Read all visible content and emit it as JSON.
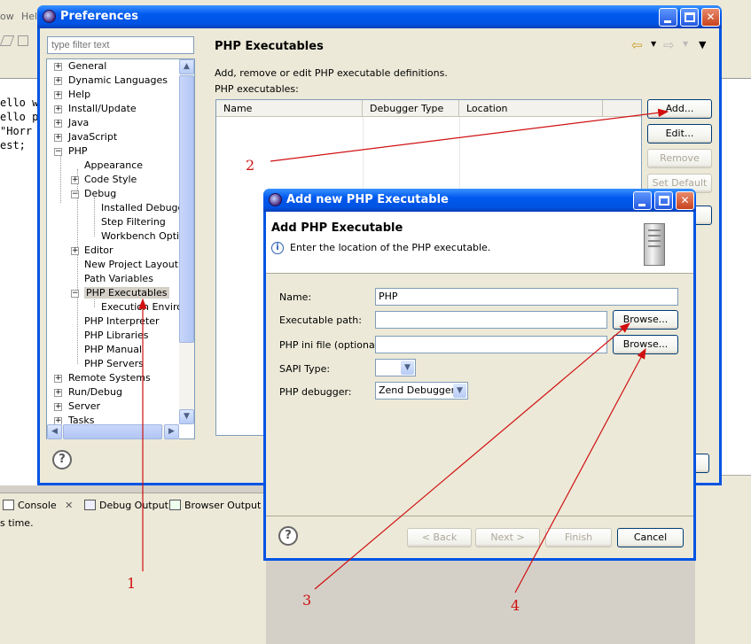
{
  "background": {
    "menu": [
      "ow",
      "Help"
    ],
    "editor_lines": [
      "ello w",
      "ello p",
      "\"Horr",
      "est;"
    ],
    "console_tabs": [
      "Console",
      "Debug Output",
      "Browser Output"
    ],
    "console_text": "s time."
  },
  "preferences": {
    "title": "Preferences",
    "filter_placeholder": "type filter text",
    "tree": {
      "general": "General",
      "dynamic_languages": "Dynamic Languages",
      "help": "Help",
      "install_update": "Install/Update",
      "java": "Java",
      "javascript": "JavaScript",
      "php": "PHP",
      "appearance": "Appearance",
      "code_style": "Code Style",
      "debug": "Debug",
      "installed_debuggers": "Installed Debugge",
      "step_filtering": "Step Filtering",
      "workbench_options": "Workbench Option",
      "editor": "Editor",
      "new_project_layout": "New Project Layout",
      "path_variables": "Path Variables",
      "php_executables": "PHP Executables",
      "execution_environments": "Execution Environ",
      "php_interpreter": "PHP Interpreter",
      "php_libraries": "PHP Libraries",
      "php_manual": "PHP Manual",
      "php_servers": "PHP Servers",
      "remote_systems": "Remote Systems",
      "run_debug": "Run/Debug",
      "server": "Server",
      "tasks": "Tasks"
    },
    "page_title": "PHP Executables",
    "description": "Add, remove or edit PHP executable definitions.",
    "list_label": "PHP executables:",
    "columns": [
      "Name",
      "Debugger Type",
      "Location"
    ],
    "buttons": {
      "add": "Add...",
      "edit": "Edit...",
      "remove": "Remove",
      "set_default": "Set Default"
    }
  },
  "dialog": {
    "title": "Add new PHP Executable",
    "banner_title": "Add PHP Executable",
    "banner_desc": "Enter the location of the PHP executable.",
    "fields": {
      "name_label": "Name:",
      "name_value": "PHP",
      "exec_label": "Executable path:",
      "exec_value": "",
      "ini_label": "PHP ini file (optional):",
      "ini_value": "",
      "sapi_label": "SAPI Type:",
      "sapi_value": "",
      "debugger_label": "PHP debugger:",
      "debugger_value": "Zend Debugger"
    },
    "browse": "Browse...",
    "buttons": {
      "back": "< Back",
      "next": "Next >",
      "finish": "Finish",
      "cancel": "Cancel"
    }
  },
  "annotations": [
    "1",
    "2",
    "3",
    "4"
  ],
  "colors": {
    "titlebar": "#0054e3",
    "annotation": "#d01010",
    "selection": "#d4d0c8"
  }
}
